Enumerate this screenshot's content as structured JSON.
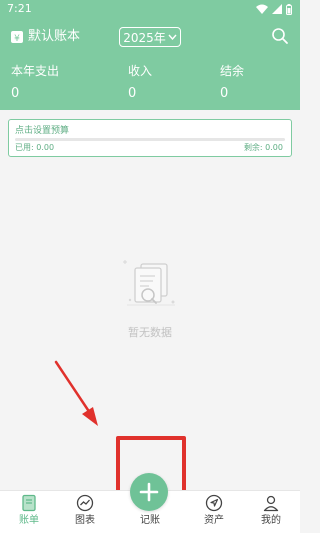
{
  "status_bar": {
    "time": "7:21"
  },
  "header": {
    "book_name": "默认账本",
    "year": "2025年",
    "stats": [
      {
        "label": "本年支出",
        "value": "0"
      },
      {
        "label": "收入",
        "value": "0"
      },
      {
        "label": "结余",
        "value": "0"
      }
    ]
  },
  "budget": {
    "title": "点击设置预算",
    "used_label": "已用: 0.00",
    "remaining_label": "剩余: 0.00"
  },
  "empty_state": {
    "text": "暂无数据"
  },
  "bottom_nav": {
    "items": [
      {
        "label": "账单",
        "icon": "bill-icon",
        "active": true
      },
      {
        "label": "图表",
        "icon": "chart-icon",
        "active": false
      },
      {
        "label": "记账",
        "icon": "add-icon",
        "active": false
      },
      {
        "label": "资产",
        "icon": "asset-icon",
        "active": false
      },
      {
        "label": "我的",
        "icon": "profile-icon",
        "active": false
      }
    ]
  },
  "colors": {
    "brand": "#7fcba1",
    "fab": "#6fc297",
    "annotation": "#e0312c"
  }
}
